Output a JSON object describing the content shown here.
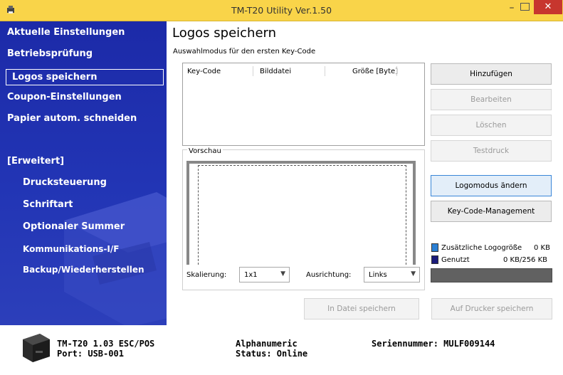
{
  "window": {
    "title": "TM-T20 Utility Ver.1.50",
    "minimize": "–",
    "close": "✕",
    "titlebar_color": "#f9d449"
  },
  "sidebar": {
    "items": [
      {
        "label": "Aktuelle Einstellungen"
      },
      {
        "label": "Betriebsprüfung"
      },
      {
        "label": "Logos speichern",
        "selected": true
      },
      {
        "label": "Coupon-Einstellungen"
      },
      {
        "label": "Papier autom. schneiden"
      }
    ],
    "advanced_heading": "[Erweitert]",
    "advanced_items": [
      {
        "label": "Drucksteuerung"
      },
      {
        "label": "Schriftart"
      },
      {
        "label": "Optionaler Summer"
      },
      {
        "label": "Kommunikations-I/F"
      },
      {
        "label": "Backup/Wiederherstellen"
      }
    ],
    "background_color": "#1f2eae"
  },
  "main": {
    "title": "Logos speichern",
    "selection_mode_label": "Auswahlmodus für den ersten Key-Code",
    "table": {
      "columns": [
        "Key-Code",
        "Bilddatei",
        "Größe [Byte]"
      ],
      "rows": []
    },
    "preview_label": "Vorschau",
    "scaling_label": "Skalierung:",
    "scaling_value": "1x1",
    "alignment_label": "Ausrichtung:",
    "alignment_value": "Links"
  },
  "buttons": {
    "add": "Hinzufügen",
    "edit": "Bearbeiten",
    "delete": "Löschen",
    "test_print": "Testdruck",
    "change_logo_mode": "Logomodus ändern",
    "key_code_management": "Key-Code-Management",
    "save_to_file": "In Datei speichern",
    "save_to_printer": "Auf Drucker speichern"
  },
  "memory": {
    "additional_label": "Zusätzliche Logogröße",
    "additional_value": "0 KB",
    "used_label": "Genutzt",
    "used_value": "0 KB/256 KB",
    "additional_color": "#2a7fd4",
    "used_color": "#1a1a7a",
    "used_fraction": 0
  },
  "status": {
    "model": "TM-T20 1.03 ESC/POS",
    "port": "Port: USB-001",
    "charset": "Alphanumeric",
    "status": "Status: Online",
    "serial": "Seriennummer: MULF009144"
  }
}
